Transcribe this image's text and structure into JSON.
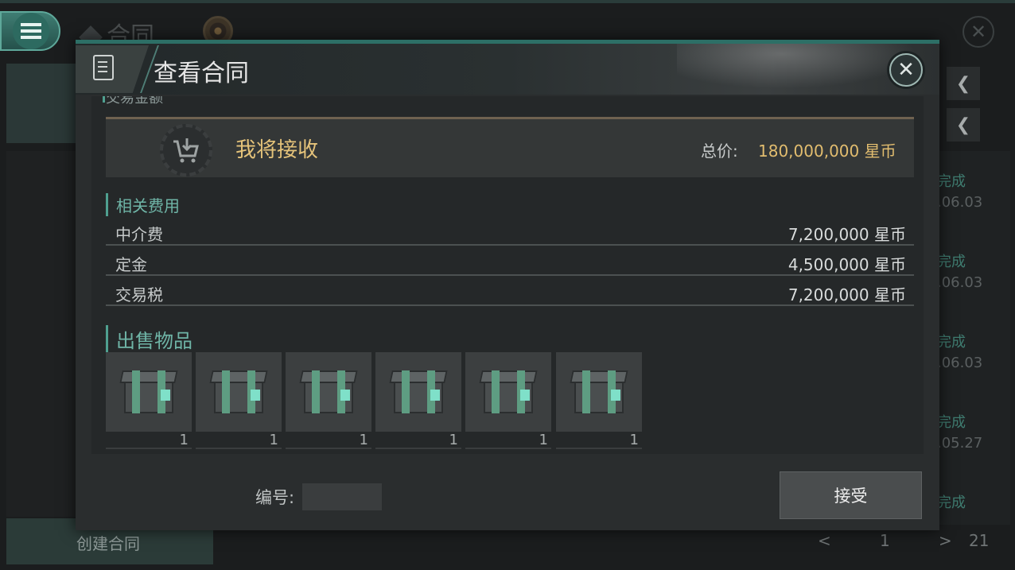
{
  "background": {
    "title": "合同",
    "create_button": "创建合同",
    "entries": [
      {
        "status": "完成",
        "date": ".06.03"
      },
      {
        "status": "完成",
        "date": ".06.03"
      },
      {
        "status": "完成",
        "date": ".06.03"
      },
      {
        "status": "完成",
        "date": ".05.27"
      },
      {
        "status": "完成",
        "date": ""
      }
    ],
    "pager": {
      "current": "1",
      "total": "21",
      "prev": "<",
      "next": ">"
    },
    "close_glyph": "✕"
  },
  "dialog": {
    "title": "查看合同",
    "close_glyph": "✕",
    "cut_section_label": "交易金额",
    "receive_text": "我将接收",
    "total_label": "总价:",
    "total_value": "180,000,000 星币",
    "fees_label": "相关费用",
    "fees": [
      {
        "name": "中介费",
        "value": "7,200,000 星币"
      },
      {
        "name": "定金",
        "value": "4,500,000 星币"
      },
      {
        "name": "交易税",
        "value": "7,200,000 星币"
      }
    ],
    "items_label": "出售物品",
    "items": [
      {
        "icon": "crate-icon",
        "count": "1"
      },
      {
        "icon": "crate-icon",
        "count": "1"
      },
      {
        "icon": "crate-icon",
        "count": "1"
      },
      {
        "icon": "crate-icon",
        "count": "1"
      },
      {
        "icon": "crate-icon",
        "count": "1"
      },
      {
        "icon": "crate-icon",
        "count": "1"
      }
    ],
    "id_label": "编号:",
    "accept_button": "接受"
  },
  "colors": {
    "accent_teal": "#4fa090",
    "gold_text": "#e5c37a",
    "dialog_bg": "#2a2d2e"
  }
}
